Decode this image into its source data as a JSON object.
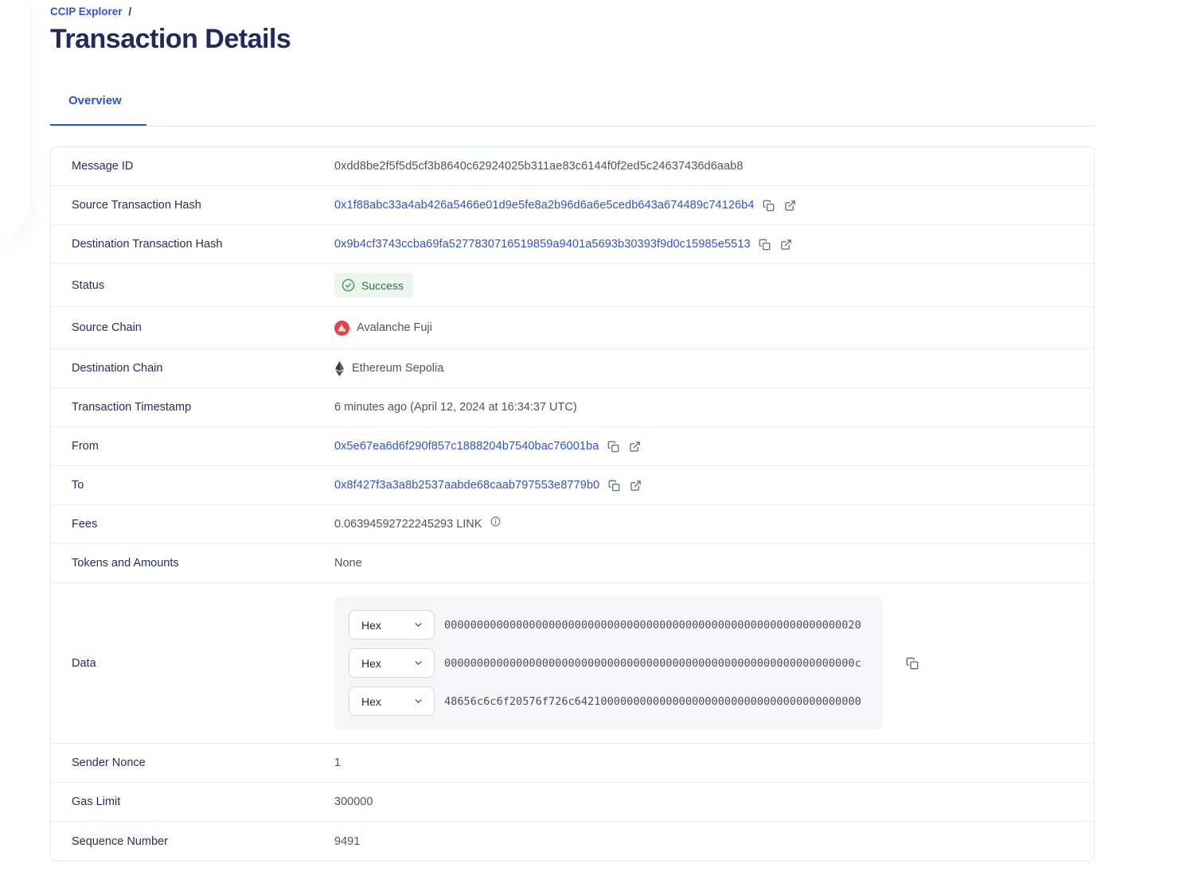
{
  "header": {
    "breadcrumb": "CCIP Explorer",
    "breadcrumb_separator": "/",
    "title": "Transaction Details"
  },
  "tabs": {
    "overview": "Overview"
  },
  "fields": {
    "message_id": {
      "label": "Message ID",
      "value": "0xdd8be2f5f5d5cf3b8640c62924025b311ae83c6144f0f2ed5c24637436d6aab8"
    },
    "source_tx": {
      "label": "Source Transaction Hash",
      "value": "0x1f88abc33a4ab426a5466e01d9e5fe8a2b96d6a6e5cedb643a674489c74126b4"
    },
    "dest_tx": {
      "label": "Destination Transaction Hash",
      "value": "0x9b4cf3743ccba69fa5277830716519859a9401a5693b30393f9d0c15985e5513"
    },
    "status": {
      "label": "Status",
      "value": "Success"
    },
    "source_chain": {
      "label": "Source Chain",
      "value": "Avalanche Fuji"
    },
    "dest_chain": {
      "label": "Destination Chain",
      "value": "Ethereum Sepolia"
    },
    "timestamp": {
      "label": "Transaction Timestamp",
      "value": "6 minutes ago (April 12, 2024 at 16:34:37 UTC)"
    },
    "from": {
      "label": "From",
      "value": "0x5e67ea6d6f290f857c1888204b7540bac76001ba"
    },
    "to": {
      "label": "To",
      "value": "0x8f427f3a3a8b2537aabde68caab797553e8779b0"
    },
    "fees": {
      "label": "Fees",
      "value": "0.06394592722245293 LINK"
    },
    "tokens": {
      "label": "Tokens and Amounts",
      "value": "None"
    },
    "data": {
      "label": "Data",
      "format_selector": "Hex",
      "lines": [
        "0000000000000000000000000000000000000000000000000000000000000020",
        "000000000000000000000000000000000000000000000000000000000000000c",
        "48656c6c6f20576f726c64210000000000000000000000000000000000000000"
      ]
    },
    "sender_nonce": {
      "label": "Sender Nonce",
      "value": "1"
    },
    "gas_limit": {
      "label": "Gas Limit",
      "value": "300000"
    },
    "sequence_number": {
      "label": "Sequence Number",
      "value": "9491"
    }
  },
  "icons": {
    "copy": "copy-icon",
    "external": "external-link-icon",
    "success_check": "check-circle-icon",
    "info": "info-icon",
    "avalanche": "avalanche-logo-icon",
    "ethereum": "ethereum-logo-icon",
    "chevron": "chevron-down-icon"
  },
  "colors": {
    "accent_blue": "#3352cd",
    "title_navy": "#202a60",
    "label_navy": "#252f5e",
    "value_gray": "#4d5462",
    "success_text": "#2e6f3e",
    "success_bg": "#edf6ee",
    "success_icon": "#3a9e52",
    "avalanche_red": "#e84142",
    "data_box_bg": "#f6f6f8"
  }
}
